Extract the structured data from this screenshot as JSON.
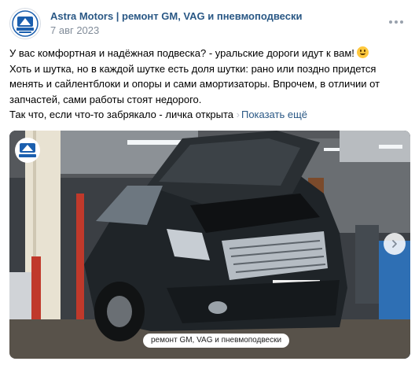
{
  "post": {
    "author": "Astra Motors | ремонт GM, VAG и пневмоподвески",
    "date": "7 авг 2023",
    "text_lines": [
      "У вас комфортная и надёжная подвеска? - уральские дороги идут к вам!",
      "Хоть и шутка, но в каждой шутке есть доля шутки: рано или поздно придется",
      "менять и сайлентблоки и опоры и сами амортизаторы. Впрочем, в отличии от",
      "запчастей, сами работы стоят недорого."
    ],
    "last_line": "Так что, если что-то забрякало - личка открыта",
    "last_line_fade": " ",
    "show_more": "Показать ещё"
  },
  "photo": {
    "caption": "ремонт GM, VAG и пневмоподвески",
    "description_icon": "car-photo"
  },
  "icons": {
    "avatar": "astra-motors-logo",
    "more": "more-dots-icon",
    "next": "chevron-right-icon"
  },
  "colors": {
    "link": "#2a5885",
    "secondary": "#818c99",
    "logo_blue": "#1b5fae"
  }
}
